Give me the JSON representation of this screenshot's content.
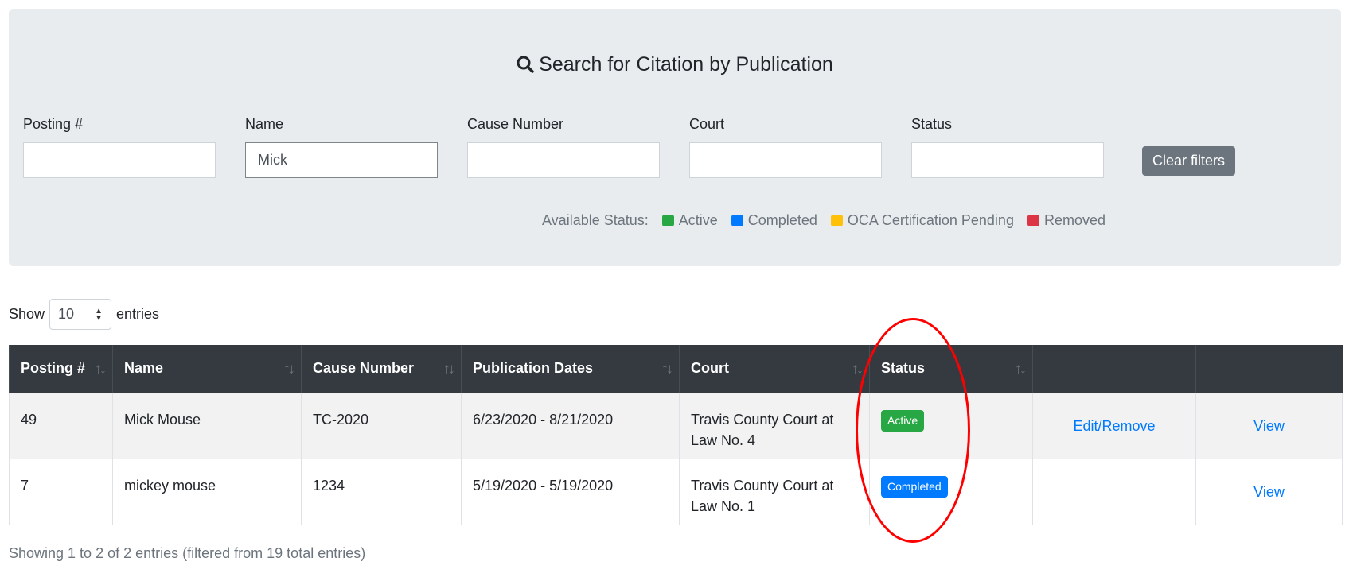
{
  "search": {
    "title": "Search for Citation by Publication",
    "fields": [
      {
        "label": "Posting #",
        "value": "",
        "placeholder": ""
      },
      {
        "label": "Name",
        "value": "Mick",
        "placeholder": ""
      },
      {
        "label": "Cause Number",
        "value": "",
        "placeholder": ""
      },
      {
        "label": "Court",
        "value": "",
        "placeholder": ""
      },
      {
        "label": "Status",
        "value": "",
        "placeholder": ""
      }
    ],
    "clear_label": "Clear filters",
    "legend_label": "Available Status:",
    "legend": [
      {
        "label": "Active",
        "color": "#28a745"
      },
      {
        "label": "Completed",
        "color": "#007bff"
      },
      {
        "label": "OCA Certification Pending",
        "color": "#ffc107"
      },
      {
        "label": "Removed",
        "color": "#dc3545"
      }
    ]
  },
  "entries": {
    "show_label": "Show",
    "value": "10",
    "suffix": "entries"
  },
  "table": {
    "columns": [
      "Posting #",
      "Name",
      "Cause Number",
      "Publication Dates",
      "Court",
      "Status",
      "",
      ""
    ],
    "rows": [
      {
        "posting": "49",
        "name": "Mick Mouse",
        "cause": "TC-2020",
        "dates": "6/23/2020 - 8/21/2020",
        "court": "Travis County Court at Law No. 4",
        "status": "Active",
        "status_color": "#28a745",
        "edit": "Edit/Remove",
        "view": "View"
      },
      {
        "posting": "7",
        "name": "mickey mouse",
        "cause": "1234",
        "dates": "5/19/2020 - 5/19/2020",
        "court": "Travis County Court at Law No. 1",
        "status": "Completed",
        "status_color": "#007bff",
        "edit": "",
        "view": "View"
      }
    ],
    "info": "Showing 1 to 2 of 2 entries (filtered from 19 total entries)"
  }
}
